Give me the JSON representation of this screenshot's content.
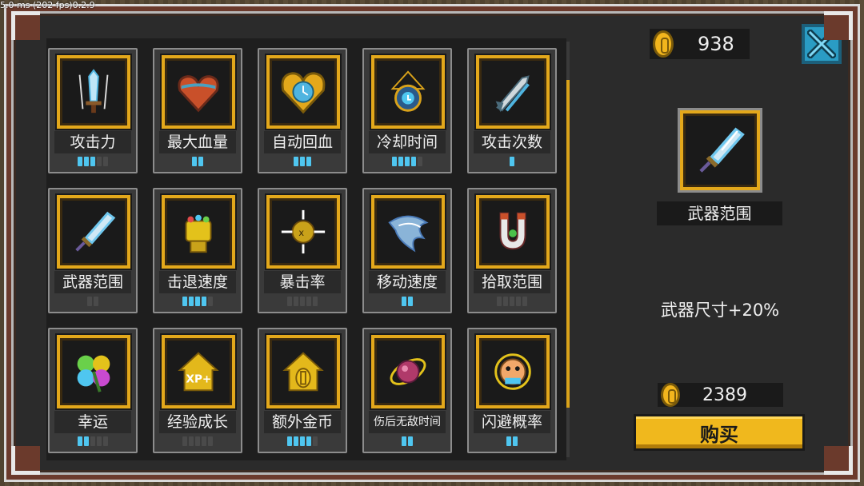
{
  "debug_text": "5.0 ms (202 fps)0.2.9",
  "gold": "938",
  "upgrades": [
    {
      "name": "攻击力",
      "icon": "sword-aura-icon",
      "level": 3,
      "max": 5
    },
    {
      "name": "最大血量",
      "icon": "heart-icon",
      "level": 2,
      "max": 2
    },
    {
      "name": "自动回血",
      "icon": "heart-clock-icon",
      "level": 3,
      "max": 3
    },
    {
      "name": "冷却时间",
      "icon": "pocket-watch-icon",
      "level": 4,
      "max": 5
    },
    {
      "name": "攻击次数",
      "icon": "missiles-icon",
      "level": 1,
      "max": 1
    },
    {
      "name": "武器范围",
      "icon": "big-sword-icon",
      "level": 0,
      "max": 2
    },
    {
      "name": "击退速度",
      "icon": "gauntlet-icon",
      "level": 4,
      "max": 5
    },
    {
      "name": "暴击率",
      "icon": "crit-orb-icon",
      "level": 0,
      "max": 5
    },
    {
      "name": "移动速度",
      "icon": "wind-wing-icon",
      "level": 2,
      "max": 2
    },
    {
      "name": "拾取范围",
      "icon": "magnet-icon",
      "level": 0,
      "max": 5
    },
    {
      "name": "幸运",
      "icon": "clover-icon",
      "level": 2,
      "max": 5
    },
    {
      "name": "经验成长",
      "icon": "xp-house-icon",
      "level": 0,
      "max": 5
    },
    {
      "name": "额外金币",
      "icon": "coin-house-icon",
      "level": 4,
      "max": 5
    },
    {
      "name": "伤后无敌时间",
      "icon": "ring-orb-icon",
      "level": 2,
      "max": 2
    },
    {
      "name": "闪避概率",
      "icon": "dodge-face-icon",
      "level": 2,
      "max": 2
    }
  ],
  "selected": {
    "name": "武器范围",
    "icon": "big-sword-icon",
    "description": "武器尺寸+20%",
    "price": "2389"
  },
  "buy_label": "购买",
  "colors": {
    "accent_gold": "#e3a81b",
    "pip_on": "#4fc6f0",
    "pip_off": "#4a4a4a",
    "close_blue": "#2a9cc4"
  }
}
